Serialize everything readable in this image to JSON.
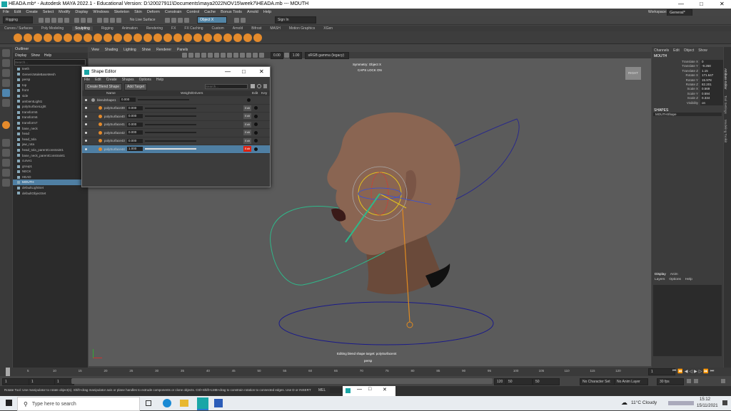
{
  "window": {
    "title": "HEADA.mb* - Autodesk MAYA 2022.1 - Educational Version: D:\\20027911\\Documents\\maya2022NOV15\\week7\\HEADA.mb  ---  MOUTH"
  },
  "menubar": [
    "File",
    "Edit",
    "Create",
    "Select",
    "Modify",
    "Display",
    "Windows",
    "Skeleton",
    "Skin",
    "Deform",
    "Constrain",
    "Control",
    "Cache",
    "Bonus Tools",
    "Arnold",
    "Help"
  ],
  "statusline": {
    "mode": "Rigging",
    "live_surface": "No Live Surface",
    "symmetry": "Object X",
    "signin": "Sign In",
    "workspace_label": "Workspace:",
    "workspace": "General*"
  },
  "shelf_tabs": [
    "Curves / Surfaces",
    "Poly Modeling",
    "Sculpting",
    "Rigging",
    "Animation",
    "Rendering",
    "FX",
    "FX Caching",
    "Custom",
    "Arnold",
    "Bifrost",
    "MASH",
    "Motion Graphics",
    "XGen"
  ],
  "shelf_active": "Sculpting",
  "outliner": {
    "title": "Outliner",
    "menu": [
      "Display",
      "Show",
      "Help"
    ],
    "search_placeholder": "Search...",
    "items": [
      {
        "label": "teeth",
        "sel": false
      },
      {
        "label": "GenericMaleBaseMesh",
        "sel": false
      },
      {
        "label": "persp",
        "sel": false
      },
      {
        "label": "top",
        "sel": false
      },
      {
        "label": "front",
        "sel": false
      },
      {
        "label": "side",
        "sel": false
      },
      {
        "label": "ambientLight1",
        "sel": false
      },
      {
        "label": "polySurfaceLight",
        "sel": false
      },
      {
        "label": "transform5",
        "sel": false
      },
      {
        "label": "transform6",
        "sel": false
      },
      {
        "label": "transform7",
        "sel": false
      },
      {
        "label": "base_neck",
        "sel": false
      },
      {
        "label": "head",
        "sel": false
      },
      {
        "label": "head_tola",
        "sel": false
      },
      {
        "label": "jaw_rota",
        "sel": false
      },
      {
        "label": "head_tola_parentConstraint1",
        "sel": false
      },
      {
        "label": "base_neck_parentConstraint1",
        "sel": false
      },
      {
        "label": "curve1",
        "sel": false
      },
      {
        "label": "group1",
        "sel": false
      },
      {
        "label": "NECK",
        "sel": false
      },
      {
        "label": "HEAD",
        "sel": false
      },
      {
        "label": "MOUTH",
        "sel": true
      },
      {
        "label": "defaultLightSet",
        "sel": false
      },
      {
        "label": "defaultObjectSet",
        "sel": false
      }
    ]
  },
  "viewport": {
    "menu": [
      "View",
      "Shading",
      "Lighting",
      "Show",
      "Renderer",
      "Panels"
    ],
    "field_a": "0.00",
    "field_b": "1.00",
    "colorspace": "sRGB gamma (legacy)",
    "hud_symmetry": "Symmetry: Object X",
    "hud_caps": "CAPS LOCK ON",
    "status_msg": "Editing blend shape target: polySurface44",
    "camera": "persp",
    "viewcube": "RIGHT"
  },
  "shape_editor": {
    "title": "Shape Editor",
    "menu": [
      "File",
      "Edit",
      "Create",
      "Shapes",
      "Options",
      "Help"
    ],
    "create_btn": "Create Blend Shape",
    "add_btn": "Add Target",
    "search_placeholder": "Search...",
    "col_name": "Name",
    "col_weight": "Weight/Drivers",
    "col_edit": "Edit",
    "col_key": "Key",
    "rows": [
      {
        "name": "blendShape1",
        "weight": "0.000",
        "level": 0,
        "fill": 0.0,
        "edit": false,
        "active": false,
        "sel": false
      },
      {
        "name": "polySurface39",
        "weight": "0.000",
        "level": 1,
        "fill": 0.0,
        "edit": true,
        "active": false,
        "sel": false
      },
      {
        "name": "polySurface40",
        "weight": "0.000",
        "level": 1,
        "fill": 0.0,
        "edit": true,
        "active": false,
        "sel": false
      },
      {
        "name": "polySurface41",
        "weight": "0.000",
        "level": 1,
        "fill": 0.0,
        "edit": true,
        "active": false,
        "sel": false
      },
      {
        "name": "polySurface42",
        "weight": "0.000",
        "level": 1,
        "fill": 0.0,
        "edit": true,
        "active": false,
        "sel": false
      },
      {
        "name": "polySurface43",
        "weight": "0.000",
        "level": 1,
        "fill": 0.0,
        "edit": true,
        "active": false,
        "sel": false
      },
      {
        "name": "polySurface44",
        "weight": "1.000",
        "level": 1,
        "fill": 1.0,
        "edit": true,
        "active": true,
        "sel": true
      }
    ],
    "edit_label": "Edit"
  },
  "channel_box": {
    "menu": [
      "Channels",
      "Edit",
      "Object",
      "Show"
    ],
    "object": "MOUTH",
    "attributes": [
      {
        "label": "Translate X",
        "value": "0"
      },
      {
        "label": "Translate Y",
        "value": "-9.268"
      },
      {
        "label": "Translate Z",
        "value": "1.15"
      },
      {
        "label": "Rotate X",
        "value": "171.647"
      },
      {
        "label": "Rotate Y",
        "value": "15.978"
      },
      {
        "label": "Rotate Z",
        "value": "82.201"
      },
      {
        "label": "Scale X",
        "value": "0.569"
      },
      {
        "label": "Scale Y",
        "value": "0.594"
      },
      {
        "label": "Scale Z",
        "value": "0.334"
      },
      {
        "label": "Visibility",
        "value": "on"
      }
    ],
    "shapes_header": "SHAPES",
    "shape": "MOUTHShape",
    "layer_tabs": [
      "Display",
      "Anim"
    ],
    "layer_menu": [
      "Layers",
      "Options",
      "Help"
    ]
  },
  "timeline": {
    "ticks": [
      "5",
      "10",
      "15",
      "20",
      "25",
      "30",
      "35",
      "40",
      "45",
      "50",
      "55",
      "60",
      "65",
      "70",
      "75",
      "80",
      "85",
      "90",
      "95",
      "100",
      "105",
      "110",
      "115",
      "120"
    ],
    "current": "1",
    "start": "1",
    "end": "120",
    "range_start": "1",
    "range_end": "1",
    "anim_end": "120",
    "anim_end2": "200",
    "fps": "30 fps",
    "character_set": "No Character Set",
    "anim_layer": "No Anim Layer",
    "field_1": "50",
    "field_2": "50"
  },
  "help_line": {
    "text": "Rotate Tool: Use manipulator to rotate object(s). Shift+drag manipulator axis or plane handles to extrude components or clone objects. Ctrl+Shift+LMB+drag to constrain rotation to connected edges. Use D or INSERT to change the pivot p...",
    "mel": "MEL"
  },
  "taskbar": {
    "search": "Type here to search",
    "weather": "11°C Cloudy",
    "time": "15:12",
    "date": "15/11/2021"
  },
  "right_tabs": [
    "Attribute Editor",
    "Tool Settings",
    "Modeling Toolkit"
  ]
}
